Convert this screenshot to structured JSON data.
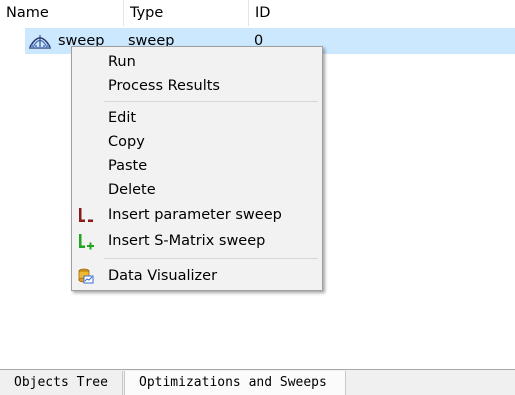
{
  "header": {
    "columns": [
      "Name",
      "Type",
      "ID"
    ]
  },
  "tree": {
    "rows": [
      {
        "name": "sweep",
        "type": "sweep",
        "id": "0",
        "icon": "parameter-sweep-icon",
        "selected": true
      }
    ]
  },
  "context_menu": {
    "items": [
      {
        "label": "Run"
      },
      {
        "label": "Process Results"
      },
      {
        "label": "Edit"
      },
      {
        "label": "Copy"
      },
      {
        "label": "Paste"
      },
      {
        "label": "Delete"
      },
      {
        "label": "Insert parameter sweep",
        "icon": "insert-parameter-sweep-icon"
      },
      {
        "label": "Insert S-Matrix sweep",
        "icon": "insert-s-matrix-sweep-icon"
      },
      {
        "label": "Data Visualizer",
        "icon": "data-visualizer-icon"
      }
    ]
  },
  "tabs": [
    {
      "label": "Objects Tree",
      "active": false
    },
    {
      "label": "Optimizations and Sweeps",
      "active": true
    }
  ],
  "colors": {
    "selection": "#cce8ff",
    "menu_background": "#f2f2f2",
    "param_sweep_icon": "#8b1a1a",
    "smatrix_sweep_icon": "#1fa51f"
  }
}
